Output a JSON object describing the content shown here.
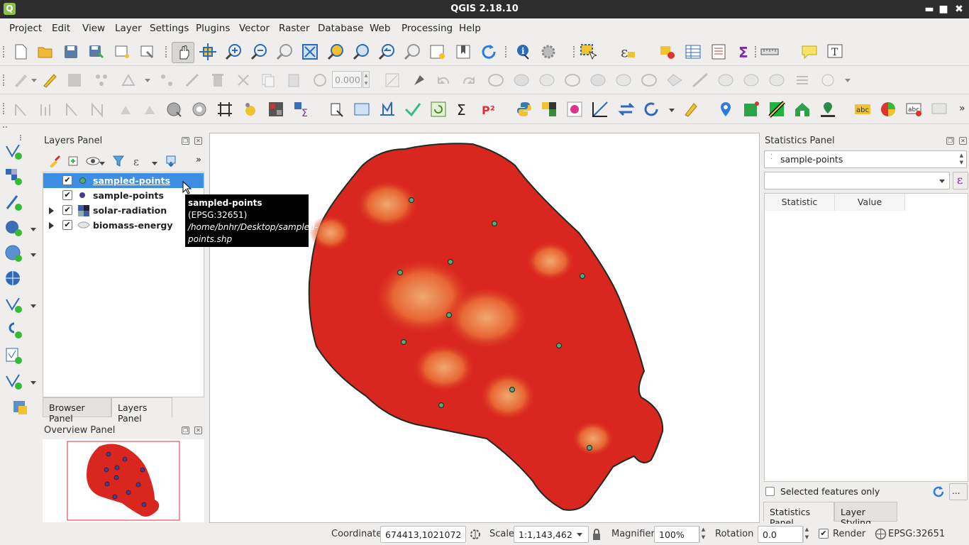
{
  "window": {
    "title": "QGIS 2.18.10",
    "logo": "Q",
    "minimize": "▬",
    "maximize": "■",
    "close": "✖"
  },
  "menu": [
    "Project",
    "Edit",
    "View",
    "Layer",
    "Settings",
    "Plugins",
    "Vector",
    "Raster",
    "Database",
    "Web",
    "Processing",
    "Help"
  ],
  "toolbar": {
    "snapping_value": "0.000"
  },
  "layers_panel": {
    "title": "Layers Panel",
    "layers": [
      {
        "name": "sampled-points",
        "checked": true,
        "selected": true,
        "icon": "point-layer-icon"
      },
      {
        "name": "sample-points",
        "checked": true,
        "selected": false,
        "icon": "point-layer-icon"
      },
      {
        "name": "solar-radiation",
        "checked": true,
        "selected": false,
        "icon": "raster-layer-icon"
      },
      {
        "name": "biomass-energy",
        "checked": true,
        "selected": false,
        "icon": "polygon-layer-icon"
      }
    ],
    "tabs": [
      "Browser Panel",
      "Layers Panel"
    ]
  },
  "tooltip": {
    "name": "sampled-points",
    "crs": "(EPSG:32651)",
    "path_line1": "/home/bnhr/Desktop/sampled-",
    "path_line2": "points.shp"
  },
  "overview_panel": {
    "title": "Overview Panel"
  },
  "statistics_panel": {
    "title": "Statistics Panel",
    "layer": "sample-points",
    "field": "",
    "columns": [
      "Statistic",
      "Value"
    ],
    "selected_only_label": "Selected features only",
    "more_btn": "...",
    "tabs": [
      "Statistics Panel",
      "Layer Styling"
    ]
  },
  "status": {
    "coordinate_label": "Coordinate",
    "coordinate": "674413,1021072",
    "scale_label": "Scale",
    "scale": "1:1,143,462",
    "magnifier_label": "Magnifier",
    "magnifier": "100%",
    "rotation_label": "Rotation",
    "rotation": "0.0",
    "render_label": "Render",
    "crs": "EPSG:32651"
  },
  "colors": {
    "selection": "#3d8ee5",
    "raster_fill": "#d9261f",
    "point_fill": "#5aa879"
  }
}
